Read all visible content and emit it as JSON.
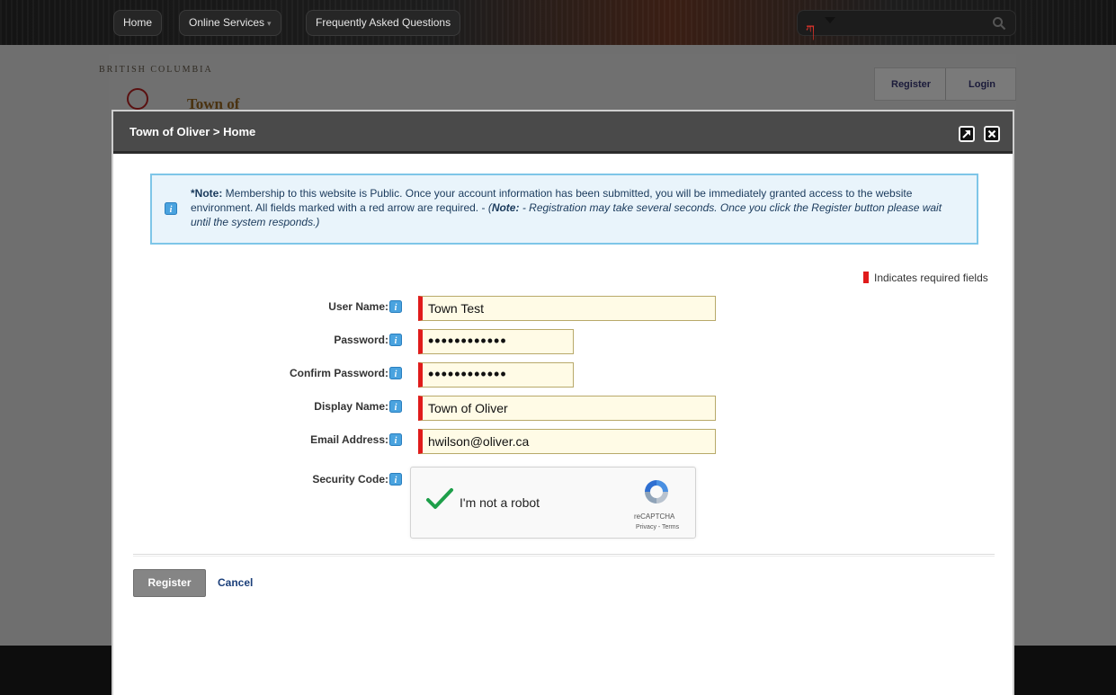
{
  "nav": {
    "items": [
      {
        "label": "Home"
      },
      {
        "label": "Online Services"
      },
      {
        "label": "Frequently Asked Questions"
      }
    ],
    "search_placeholder": ""
  },
  "header": {
    "logo_arc_text": "BRITISH COLUMBIA",
    "logo_town_text": "Town of",
    "register_label": "Register",
    "login_label": "Login"
  },
  "modal": {
    "title": "Town of Oliver > Home",
    "note": {
      "lead": "*Note:",
      "text": " Membership to this website is Public. Once your account information has been submitted, you will be immediately granted access to the website environment. All fields marked with a red arrow are required. - ",
      "italic_open": "(",
      "italic_bold": "Note:",
      "italic_text": " - Registration may take several seconds. Once you click the Register button please wait until the system responds.)"
    },
    "required_hint": "Indicates required fields",
    "fields": {
      "username": {
        "label": "User Name:",
        "value": "Town Test"
      },
      "password": {
        "label": "Password:",
        "value": "••••••••••••"
      },
      "confirm_password": {
        "label": "Confirm Password:",
        "value": "••••••••••••"
      },
      "display_name": {
        "label": "Display Name:",
        "value": "Town of Oliver"
      },
      "email": {
        "label": "Email Address:",
        "value": "hwilson@oliver.ca"
      },
      "security_code": {
        "label": "Security Code:"
      }
    },
    "captcha": {
      "text": "I'm not a robot",
      "brand": "reCAPTCHA",
      "links": "Privacy - Terms"
    },
    "buttons": {
      "register": "Register",
      "cancel": "Cancel"
    }
  },
  "colors": {
    "required_marker": "#e01b1b",
    "info_border": "#7ec6e8",
    "link": "#1b3f7a"
  }
}
